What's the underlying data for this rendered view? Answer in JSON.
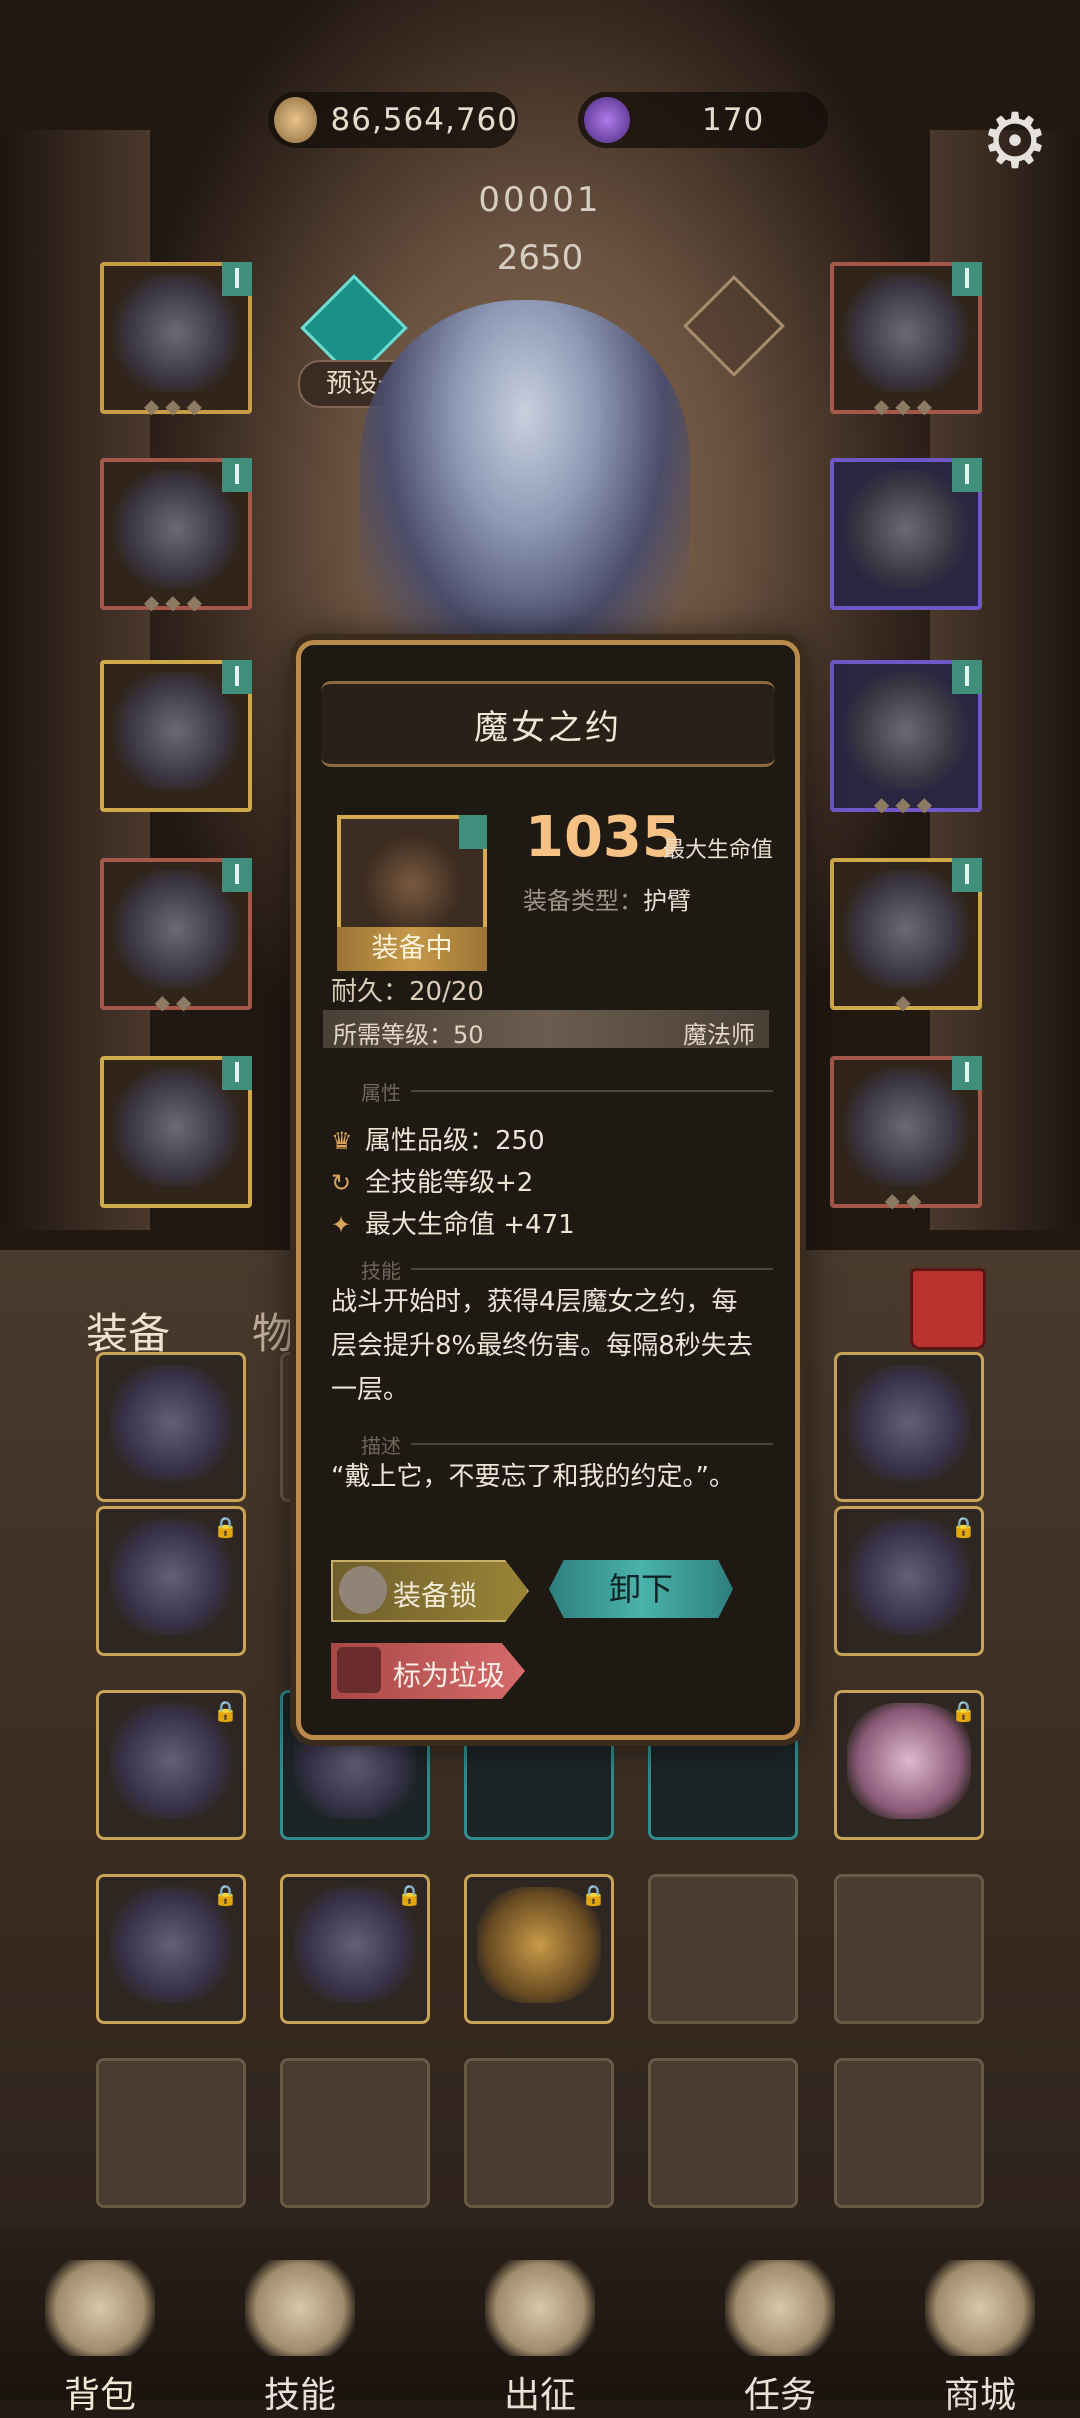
{
  "currency": {
    "gold": "86,564,760",
    "gems": "170"
  },
  "player": {
    "id": "00001",
    "power": "2650",
    "preset_label": "预设一"
  },
  "tabs": {
    "equip": "装备",
    "items": "物"
  },
  "popup": {
    "title": "魔女之约",
    "equipped_label": "装备中",
    "stat_value": "1035",
    "stat_name": "最大生命值",
    "equip_type_label": "装备类型：",
    "equip_type_value": "护臂",
    "durability_label": "耐久：",
    "durability_value": "20/20",
    "required_level": "所需等级：50",
    "required_class": "魔法师",
    "sections": {
      "attributes": "属性",
      "skills": "技能",
      "description": "描述"
    },
    "attributes": [
      "属性品级：250",
      "全技能等级+2",
      "最大生命值 +471"
    ],
    "skill_text": "战斗开始时，获得4层魔女之约，每层会提升8%最终伤害。每隔8秒失去一层。",
    "description_text": "“戴上它，不要忘了和我的约定。”。",
    "buttons": {
      "lock": "装备锁",
      "unequip": "卸下",
      "mark_trash": "标为垃圾"
    }
  },
  "nav": [
    {
      "label": "背包",
      "icon": "backpack-icon"
    },
    {
      "label": "技能",
      "icon": "skill-book-icon"
    },
    {
      "label": "出征",
      "icon": "sword-icon"
    },
    {
      "label": "任务",
      "icon": "scroll-icon"
    },
    {
      "label": "商城",
      "icon": "shop-icon"
    }
  ],
  "colors": {
    "accent_teal": "#4ab3aa",
    "gold_border": "#c89b46",
    "stat_orange": "#f6c184",
    "trash_red": "#d56b6b"
  }
}
